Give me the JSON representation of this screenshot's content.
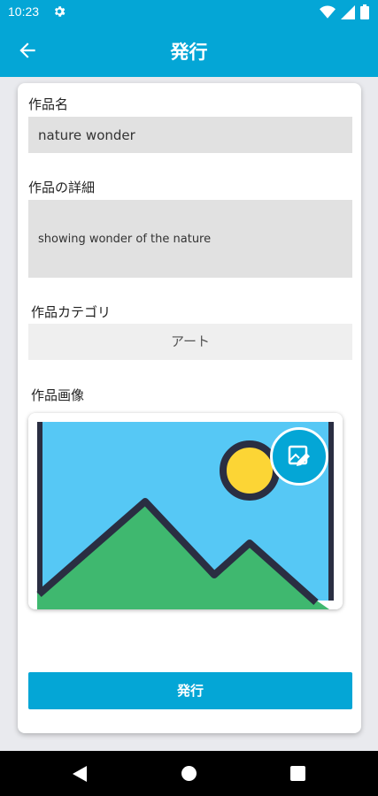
{
  "status_bar": {
    "time": "10:23"
  },
  "app_bar": {
    "title": "発行"
  },
  "form": {
    "title_label": "作品名",
    "title_value": "nature wonder",
    "detail_label": "作品の詳細",
    "detail_value": "showing wonder of the nature",
    "category_label": "作品カテゴリ",
    "category_value": "アート",
    "image_label": "作品画像",
    "submit_label": "発行"
  },
  "colors": {
    "accent": "#04a6d6",
    "image_sky": "#56c8f5",
    "image_sun": "#fcd535",
    "image_mountain": "#3fb86f",
    "image_outline": "#2a2e42"
  },
  "icons": {
    "back": "arrow-left-icon",
    "settings": "gear-icon",
    "wifi": "wifi-icon",
    "signal": "signal-icon",
    "battery": "battery-icon",
    "edit_image": "edit-image-icon"
  }
}
